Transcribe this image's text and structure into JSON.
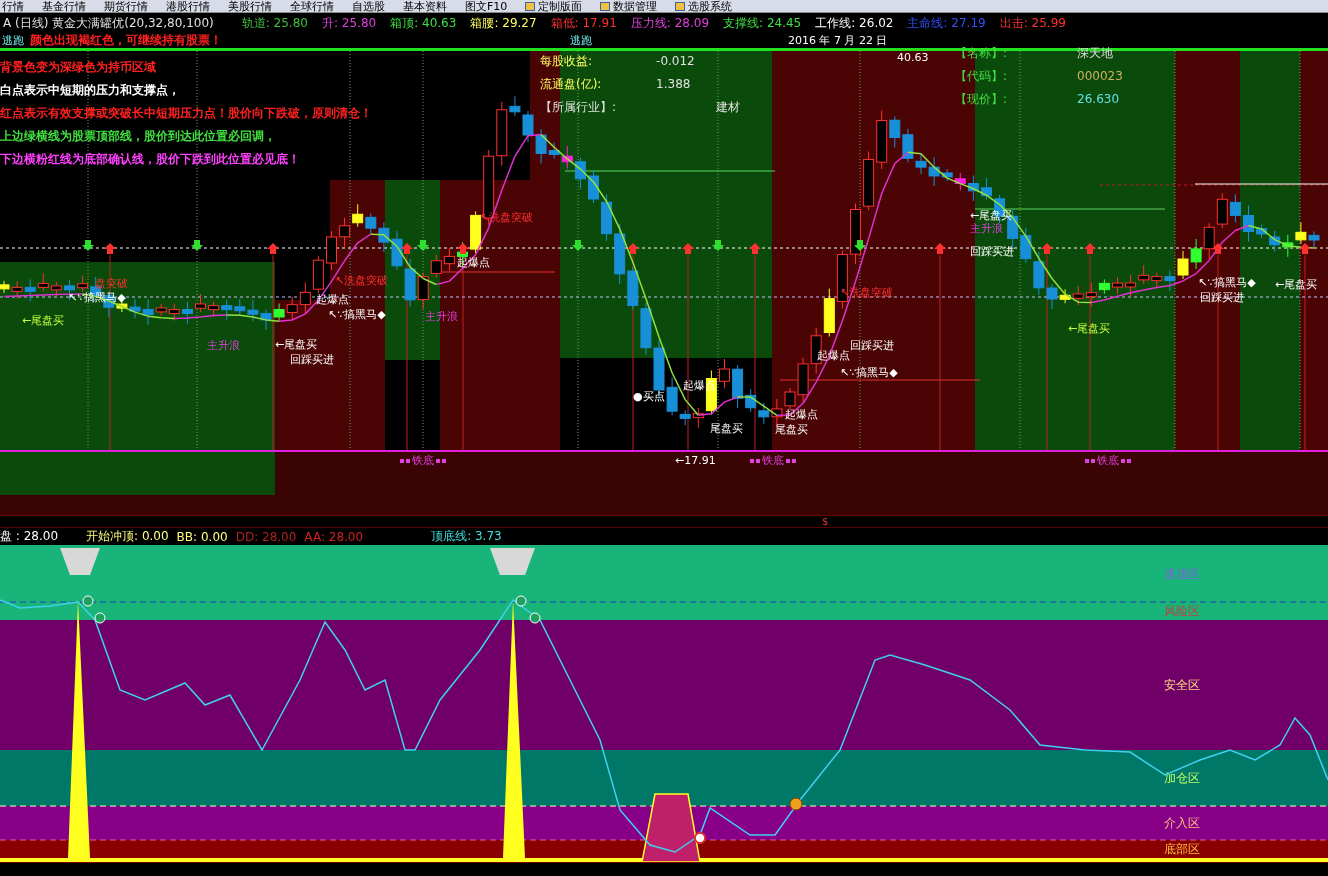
{
  "menu": [
    "行情",
    "基金行情",
    "期货行情",
    "港股行情",
    "美股行情",
    "全球行情",
    "自选股",
    "基本资料",
    "图文F10",
    "定制版面",
    "数据管理",
    "选股系统"
  ],
  "header": {
    "title": "A (日线) 黄金大满罐优(20,32,80,100)",
    "values": [
      {
        "text": "轨道: 25.80",
        "color": "#40c040"
      },
      {
        "text": "升: 25.80",
        "color": "#e040e0"
      },
      {
        "text": "箱顶: 40.63",
        "color": "#40e040"
      },
      {
        "text": "箱腰: 29.27",
        "color": "#ffff60"
      },
      {
        "text": "箱低: 17.91",
        "color": "#ff3030"
      },
      {
        "text": "压力线: 28.09",
        "color": "#e040e0"
      },
      {
        "text": "支撑线: 24.45",
        "color": "#40e040"
      },
      {
        "text": "工作线: 26.02",
        "color": "#ffffff"
      },
      {
        "text": "主命线: 27.19",
        "color": "#3050ff"
      },
      {
        "text": "出击: 25.99",
        "color": "#ff3030"
      }
    ]
  },
  "legend": [
    {
      "text": "颜色出现褐红色，可继续持有股票！",
      "color": "#ff2020"
    },
    {
      "text": "背景色变为深绿色为持币区域",
      "color": "#ff2020"
    },
    {
      "text": "白点表示中短期的压力和支撑点，",
      "color": "#ffffff"
    },
    {
      "text": "红点表示有效支撑或突破长中短期压力点！股价向下跌破，原则清仓！",
      "color": "#ff2020"
    },
    {
      "text": "上边绿横线为股票顶部线，股价到达此位置必回调，",
      "color": "#40e040"
    },
    {
      "text": "下边横粉红线为底部确认线，股价下跌到此位置必见底！",
      "color": "#ff40ff"
    }
  ],
  "date": "2016 年 7 月 22 日",
  "stock_info": [
    {
      "label": "每股收益:",
      "value": "-0.012"
    },
    {
      "label": "流通盘(亿):",
      "value": "1.388"
    },
    {
      "label": "【所属行业】:",
      "value": "建材"
    }
  ],
  "quote_info": [
    {
      "label": "【名称】:",
      "value": "深天地"
    },
    {
      "label": "【代码】:",
      "value": "000023"
    },
    {
      "label": "【现价】:",
      "value": "26.630"
    }
  ],
  "annotations": [
    {
      "text": "逃跑",
      "kind": "escape"
    },
    {
      "text": "逃跑",
      "kind": "escape"
    },
    {
      "text": "←尾盘买",
      "kind": "buy"
    },
    {
      "text": "↖∵搞黑马◆",
      "kind": "signal"
    },
    {
      "text": "盘突破",
      "kind": "breakout"
    },
    {
      "text": "主升浪",
      "kind": "wave"
    },
    {
      "text": "←尾盘买",
      "kind": "signal"
    },
    {
      "text": "回踩买进",
      "kind": "signal"
    },
    {
      "text": "起爆点",
      "kind": "signal"
    },
    {
      "text": "↖∵搞黑马◆",
      "kind": "signal"
    },
    {
      "text": "↖洗盘突破",
      "kind": "breakout"
    },
    {
      "text": "主升浪",
      "kind": "wave"
    },
    {
      "text": "起爆点",
      "kind": "signal"
    },
    {
      "text": "↖洗盘突破",
      "kind": "breakout"
    },
    {
      "text": "●买点",
      "kind": "signal"
    },
    {
      "text": "起爆点",
      "kind": "signal"
    },
    {
      "text": "尾盘买",
      "kind": "signal"
    },
    {
      "text": "←17.91",
      "kind": "signal"
    },
    {
      "text": "起爆点",
      "kind": "signal"
    },
    {
      "text": "尾盘买",
      "kind": "signal"
    },
    {
      "text": "↖洗盘突破",
      "kind": "breakout"
    },
    {
      "text": "回踩买进",
      "kind": "signal"
    },
    {
      "text": "起爆点",
      "kind": "signal"
    },
    {
      "text": "↖∵搞黑马◆",
      "kind": "signal"
    },
    {
      "text": "40.63",
      "kind": "signal"
    },
    {
      "text": "←尾盘买",
      "kind": "signal"
    },
    {
      "text": "主升浪",
      "kind": "wave"
    },
    {
      "text": "回踩买进",
      "kind": "signal"
    },
    {
      "text": "←尾盘买",
      "kind": "buy"
    },
    {
      "text": "↖∵搞黑马◆",
      "kind": "signal"
    },
    {
      "text": "回踩买进",
      "kind": "signal"
    },
    {
      "text": "←尾盘买",
      "kind": "signal"
    },
    {
      "text": "铁底",
      "kind": "floor"
    },
    {
      "text": "铁底",
      "kind": "floor"
    },
    {
      "text": "铁底",
      "kind": "floor"
    }
  ],
  "marker": "$",
  "indicator_values": [
    {
      "text": "盘 : 28.00",
      "color": "#ffffff"
    },
    {
      "text": "开始冲顶: 0.00",
      "color": "#ffff80"
    },
    {
      "text": "BB: 0.00",
      "color": "#ffff80"
    },
    {
      "text": "DD: 28.00",
      "color": "#b02020"
    },
    {
      "text": "AA: 28.00",
      "color": "#d02020"
    },
    {
      "text": "顶底线: 3.73",
      "color": "#40e0e0"
    }
  ],
  "zones": [
    "逃顶区",
    "风险区",
    "安全区",
    "加仓区",
    "介入区",
    "底部区"
  ]
}
